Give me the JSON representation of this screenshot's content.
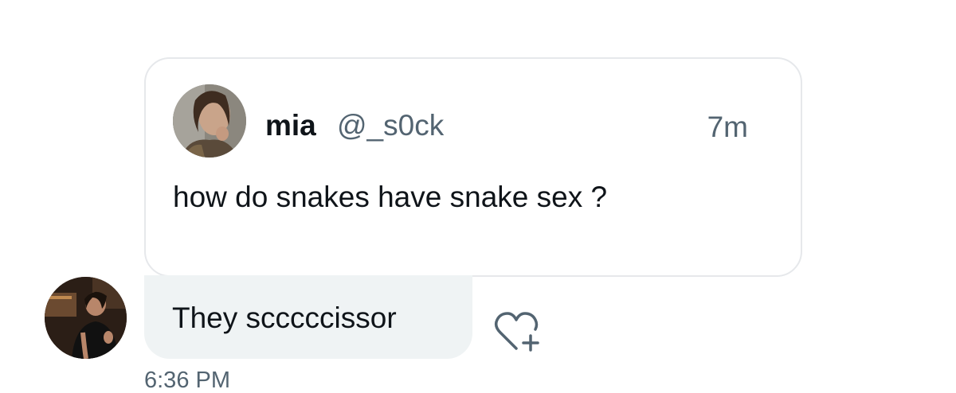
{
  "quoted_tweet": {
    "display_name": "mia",
    "handle": "@_s0ck",
    "time_ago": "7m",
    "text": "how do snakes have snake sex ?"
  },
  "reply": {
    "text": "They scccccissor",
    "sent_time": "6:36 PM"
  },
  "icons": {
    "react": "heart-plus-icon"
  },
  "colors": {
    "bubble_bg": "#eff3f4",
    "card_border": "#e6e8eb",
    "secondary_text": "#536471",
    "primary_text": "#0f1419"
  }
}
